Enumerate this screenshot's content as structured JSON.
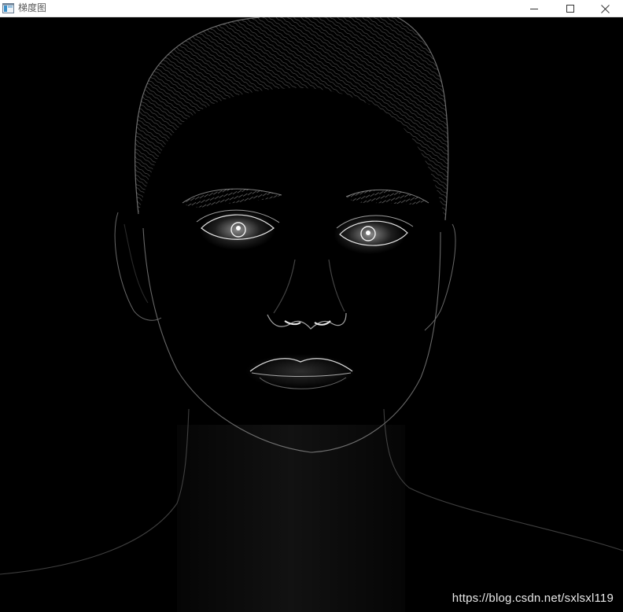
{
  "window": {
    "title": "梯度图",
    "controls": {
      "minimize_icon": "minimize-icon",
      "maximize_icon": "maximize-icon",
      "close_icon": "close-icon"
    }
  },
  "image": {
    "description_icon": "gradient-magnitude-face-image",
    "watermark": "https://blog.csdn.net/sxlsxl119"
  },
  "colors": {
    "background": "#000000",
    "titlebar": "#ffffff",
    "edge": "#ffffff"
  }
}
